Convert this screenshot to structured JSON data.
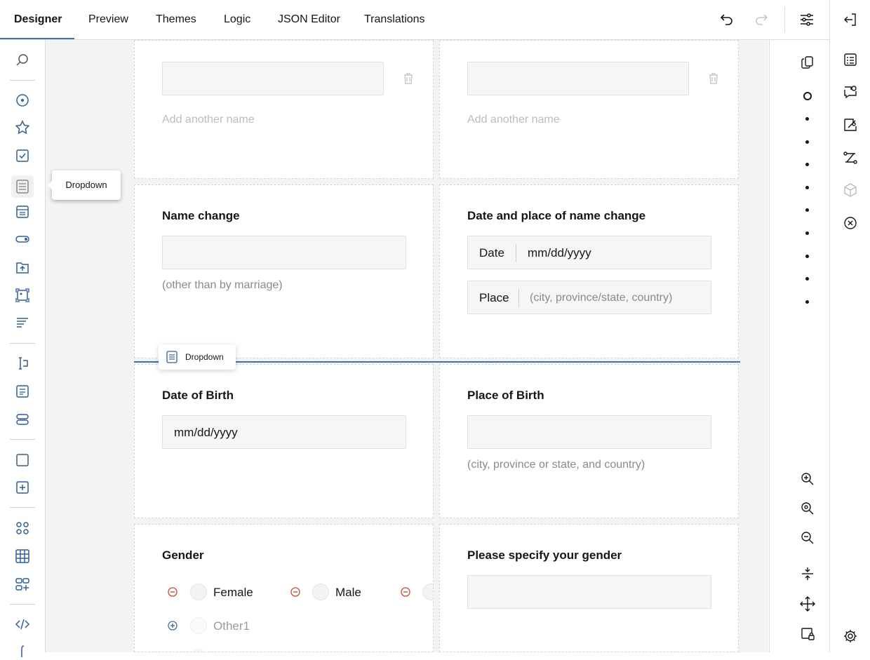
{
  "tabs": [
    {
      "label": "Designer",
      "active": true
    },
    {
      "label": "Preview"
    },
    {
      "label": "Themes"
    },
    {
      "label": "Logic"
    },
    {
      "label": "JSON Editor"
    },
    {
      "label": "Translations"
    }
  ],
  "tooltip": {
    "label": "Dropdown"
  },
  "drag_chip": {
    "label": "Dropdown"
  },
  "panels": {
    "top_left": {
      "ghost_label": "Add another name"
    },
    "top_right": {
      "ghost_label": "Add another name"
    },
    "name_change": {
      "title": "Name change",
      "hint": "(other than by marriage)"
    },
    "date_place_change": {
      "title": "Date and place of name change",
      "date_label": "Date",
      "date_placeholder": "mm/dd/yyyy",
      "place_label": "Place",
      "place_placeholder": "(city, province/state, country)"
    },
    "dob": {
      "title": "Date of Birth",
      "placeholder": "mm/dd/yyyy"
    },
    "pob": {
      "title": "Place of Birth",
      "hint": "(city, province or state, and country)"
    },
    "gender": {
      "title": "Gender",
      "choices": [
        "Female",
        "Male"
      ],
      "ghost_choice": "Other1"
    },
    "gender_specify": {
      "title": "Please specify your gender"
    }
  },
  "colors": {
    "accent": "#3b6fb6",
    "remove": "#d9482b",
    "add": "#3b6fb6"
  }
}
